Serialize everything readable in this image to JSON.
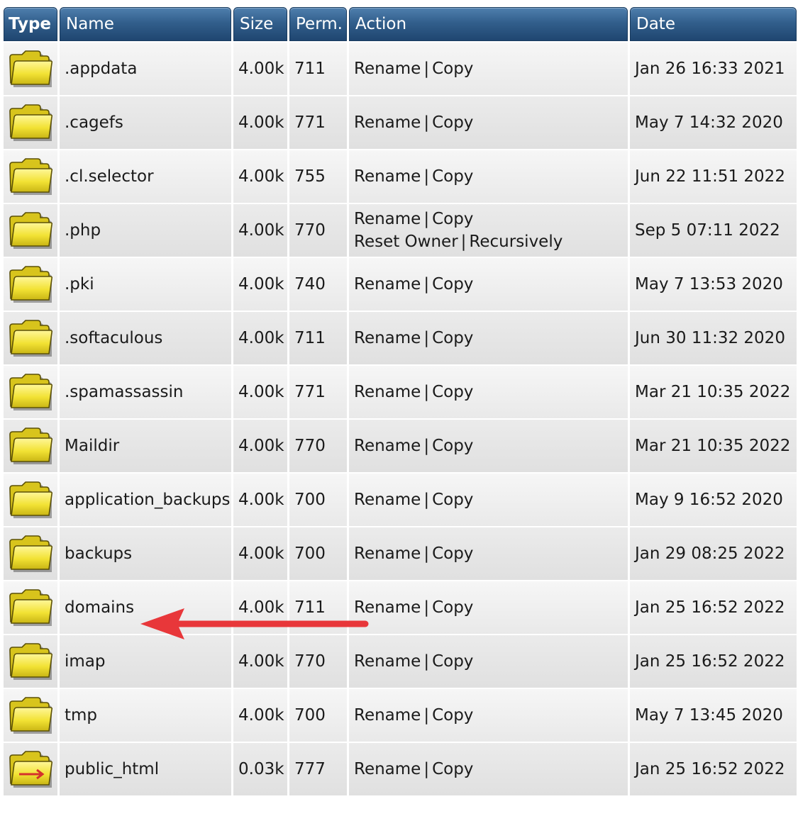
{
  "colors": {
    "header_bg": "#325f8c",
    "folder_fill": "#f2e234",
    "annotation_arrow": "#e8373a"
  },
  "columns": {
    "type": "Type",
    "name": "Name",
    "size": "Size",
    "perm": "Perm.",
    "action": "Action",
    "date": "Date"
  },
  "actions": {
    "rename": "Rename",
    "copy": "Copy",
    "separator": "|",
    "reset_owner": "Reset Owner",
    "recursively": "Recursively"
  },
  "rows": [
    {
      "icon": "folder-icon",
      "name": ".appdata",
      "size": "4.00k",
      "perm": "711",
      "date": "Jan 26 16:33 2021"
    },
    {
      "icon": "folder-icon",
      "name": ".cagefs",
      "size": "4.00k",
      "perm": "771",
      "date": "May 7 14:32 2020"
    },
    {
      "icon": "folder-icon",
      "name": ".cl.selector",
      "size": "4.00k",
      "perm": "755",
      "date": "Jun 22 11:51 2022"
    },
    {
      "icon": "folder-icon",
      "name": ".php",
      "size": "4.00k",
      "perm": "770",
      "date": "Sep 5 07:11 2022",
      "extra_actions": true
    },
    {
      "icon": "folder-icon",
      "name": ".pki",
      "size": "4.00k",
      "perm": "740",
      "date": "May 7 13:53 2020"
    },
    {
      "icon": "folder-icon",
      "name": ".softaculous",
      "size": "4.00k",
      "perm": "711",
      "date": "Jun 30 11:32 2020"
    },
    {
      "icon": "folder-icon",
      "name": ".spamassassin",
      "size": "4.00k",
      "perm": "771",
      "date": "Mar 21 10:35 2022"
    },
    {
      "icon": "folder-icon",
      "name": "Maildir",
      "size": "4.00k",
      "perm": "770",
      "date": "Mar 21 10:35 2022"
    },
    {
      "icon": "folder-icon",
      "name": "application_backups",
      "size": "4.00k",
      "perm": "700",
      "date": "May 9 16:52 2020"
    },
    {
      "icon": "folder-icon",
      "name": "backups",
      "size": "4.00k",
      "perm": "700",
      "date": "Jan 29 08:25 2022"
    },
    {
      "icon": "folder-icon",
      "name": "domains",
      "size": "4.00k",
      "perm": "711",
      "date": "Jan 25 16:52 2022",
      "annotated": true
    },
    {
      "icon": "folder-icon",
      "name": "imap",
      "size": "4.00k",
      "perm": "770",
      "date": "Jan 25 16:52 2022"
    },
    {
      "icon": "folder-icon",
      "name": "tmp",
      "size": "4.00k",
      "perm": "700",
      "date": "May 7 13:45 2020"
    },
    {
      "icon": "folder-link-icon",
      "name": "public_html",
      "size": "0.03k",
      "perm": "777",
      "date": "Jan 25 16:52 2022"
    }
  ]
}
